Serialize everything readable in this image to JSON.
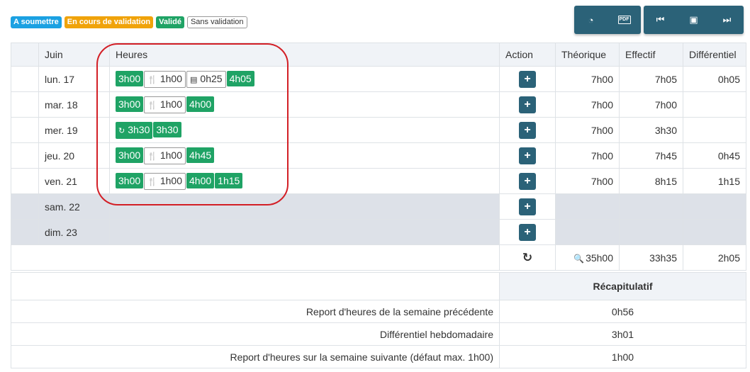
{
  "legend": [
    {
      "label": "A soumettre",
      "color": "#1ba1e2",
      "outline": false
    },
    {
      "label": "En cours de validation",
      "color": "#f0a30a",
      "outline": false
    },
    {
      "label": "Validé",
      "color": "#1fa365",
      "outline": false
    },
    {
      "label": "Sans validation",
      "color": "#ffffff",
      "outline": true
    }
  ],
  "toolbar": {
    "group1": [
      {
        "icon": "dashboard-icon",
        "glyph": "◔"
      },
      {
        "icon": "pdf-icon",
        "glyph": "PDF"
      }
    ],
    "group2": [
      {
        "icon": "skip-back-icon",
        "glyph": "⏮"
      },
      {
        "icon": "calendar-icon",
        "glyph": "▣"
      },
      {
        "icon": "skip-forward-icon",
        "glyph": "⏭"
      }
    ]
  },
  "table": {
    "headers": [
      "",
      "Juin",
      "Heures",
      "Action",
      "Théorique",
      "Effectif",
      "Différentiel"
    ],
    "rows": [
      {
        "day": "lun. 17",
        "weekend": false,
        "badges": [
          {
            "text": "3h00",
            "type": "green",
            "icon": ""
          },
          {
            "text": "1h00",
            "type": "outline",
            "icon": "fork-knife-icon"
          },
          {
            "text": "0h25",
            "type": "outline",
            "icon": "document-icon"
          },
          {
            "text": "4h05",
            "type": "green",
            "icon": ""
          }
        ],
        "theorique": "7h00",
        "effectif": "7h05",
        "differentiel": "0h05"
      },
      {
        "day": "mar. 18",
        "weekend": false,
        "badges": [
          {
            "text": "3h00",
            "type": "green",
            "icon": ""
          },
          {
            "text": "1h00",
            "type": "outline",
            "icon": "fork-knife-icon"
          },
          {
            "text": "4h00",
            "type": "green",
            "icon": ""
          }
        ],
        "theorique": "7h00",
        "effectif": "7h00",
        "differentiel": ""
      },
      {
        "day": "mer. 19",
        "weekend": false,
        "badges": [
          {
            "text": "3h30",
            "type": "green",
            "icon": "refresh-icon"
          },
          {
            "text": "3h30",
            "type": "green",
            "icon": ""
          }
        ],
        "theorique": "7h00",
        "effectif": "3h30",
        "differentiel": ""
      },
      {
        "day": "jeu. 20",
        "weekend": false,
        "badges": [
          {
            "text": "3h00",
            "type": "green",
            "icon": ""
          },
          {
            "text": "1h00",
            "type": "outline",
            "icon": "fork-knife-icon"
          },
          {
            "text": "4h45",
            "type": "green",
            "icon": ""
          }
        ],
        "theorique": "7h00",
        "effectif": "7h45",
        "differentiel": "0h45"
      },
      {
        "day": "ven. 21",
        "weekend": false,
        "badges": [
          {
            "text": "3h00",
            "type": "green",
            "icon": ""
          },
          {
            "text": "1h00",
            "type": "outline",
            "icon": "fork-knife-icon"
          },
          {
            "text": "4h00",
            "type": "green",
            "icon": ""
          },
          {
            "text": "1h15",
            "type": "green",
            "icon": ""
          }
        ],
        "theorique": "7h00",
        "effectif": "8h15",
        "differentiel": "1h15"
      },
      {
        "day": "sam. 22",
        "weekend": true,
        "badges": [],
        "theorique": "",
        "effectif": "",
        "differentiel": ""
      },
      {
        "day": "dim. 23",
        "weekend": true,
        "badges": [],
        "theorique": "",
        "effectif": "",
        "differentiel": ""
      }
    ],
    "add_label": "+",
    "totals": {
      "theorique": "35h00",
      "effectif": "33h35",
      "differentiel": "2h05"
    }
  },
  "summary": {
    "title": "Récapitulatif",
    "rows": [
      {
        "label": "Report d'heures de la semaine précédente",
        "value": "0h56"
      },
      {
        "label": "Différentiel hebdomadaire",
        "value": "3h01"
      },
      {
        "label": "Report d'heures sur la semaine suivante (défaut max. 1h00)",
        "value": "1h00"
      }
    ]
  },
  "colors": {
    "primary": "#2b6278",
    "validated": "#1fa365",
    "highlight": "#d31f26",
    "weekend": "#dde1e8"
  }
}
